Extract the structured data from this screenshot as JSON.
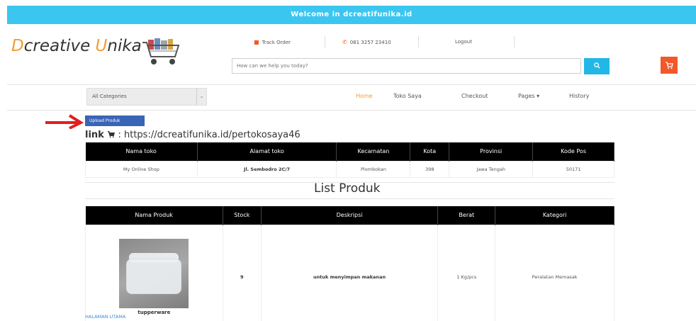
{
  "topbar": {
    "text": "Welcome in dcreatifunika.id"
  },
  "logo": {
    "d": "D",
    "creative": "creative ",
    "u": "U",
    "nika": "nika"
  },
  "utility": {
    "track_order": "Track Order",
    "phone": "081 3257 23410",
    "logout": "Logout"
  },
  "search": {
    "placeholder": "How can we help you today?"
  },
  "icons": {
    "search": "search-icon",
    "cart": "cart-icon",
    "truck": "truck-icon",
    "phone": "phone-icon",
    "chevron": "chevron-down-icon",
    "arrow": "arrow-right-icon"
  },
  "colors": {
    "accent": "#f39c2f",
    "topbar": "#3bc6f0",
    "cart": "#f1592a",
    "upload": "#3a64b5"
  },
  "nav": {
    "category": "All Categories",
    "links": [
      "Home",
      "Toko Saya",
      "Checkout",
      "Pages ▾",
      "History"
    ]
  },
  "upload_button": "Upload Produk",
  "store_link": {
    "prefix": "link ",
    "url": "https://dcreatifunika.id/pertokosaya46"
  },
  "store_table": {
    "headers": [
      "Nama toko",
      "Alamat toko",
      "Kecamatan",
      "Kota",
      "Provinsi",
      "Kode Pos"
    ],
    "row": [
      "My Online Shop",
      "Jl. Sembodro 2C/7",
      "Plombokan",
      "398",
      "Jawa Tengah",
      "50171"
    ]
  },
  "list_title": "List Produk",
  "product_table": {
    "headers": [
      "Nama Produk",
      "Stock",
      "Deskripsi",
      "Berat",
      "Kategori"
    ],
    "row": {
      "name": "tupperware",
      "stock": "9",
      "description": "untuk menyimpan makanan",
      "weight": "1 Kg/pcs",
      "category": "Peralatan Memasak"
    }
  },
  "home_link": "HALAMAN UTAMA"
}
